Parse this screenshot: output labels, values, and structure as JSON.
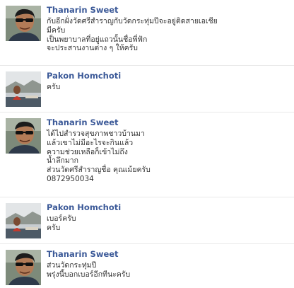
{
  "messages": [
    {
      "author": "Thanarin Sweet",
      "lines": [
        "กับอีกฝั่งวัดศรีสำราญกับวัดกระทุ่มปีจะอยู่ติดสายเอเชีย",
        "มีครับ",
        "เป็นพยาบาลที่อยู่แถวนั้นชื่อพี่ฟัก",
        "จะประสานงานต่าง ๆ ให้ครับ"
      ]
    },
    {
      "author": "Pakon Homchoti",
      "lines": [
        "ครับ"
      ]
    },
    {
      "author": "Thanarin Sweet",
      "lines": [
        "ได้ไปสำรวจสุขภาพชาวบ้านมา",
        "แล้วเขาไม่มีอะไรจะกินแล้ว",
        "ความช่วยเหลือก็เข้าไม่ถึง",
        "น้ำลึกมาก",
        "ส่วนวัดศรีสำราญชื่อ คุณเม้ยครับ",
        "0872950034"
      ]
    },
    {
      "author": "Pakon Homchoti",
      "lines": [
        "เบอร์ครับ",
        "ครับ"
      ]
    },
    {
      "author": "Thanarin Sweet",
      "lines": [
        "ส่วนวัดกระทุ่มปี",
        "พรุ่งนี้บอกเบอร์อีกทีนะครับ"
      ]
    }
  ],
  "colors": {
    "author_link": "#3b5998",
    "body_text": "#333333",
    "divider": "#e9e9e9"
  }
}
